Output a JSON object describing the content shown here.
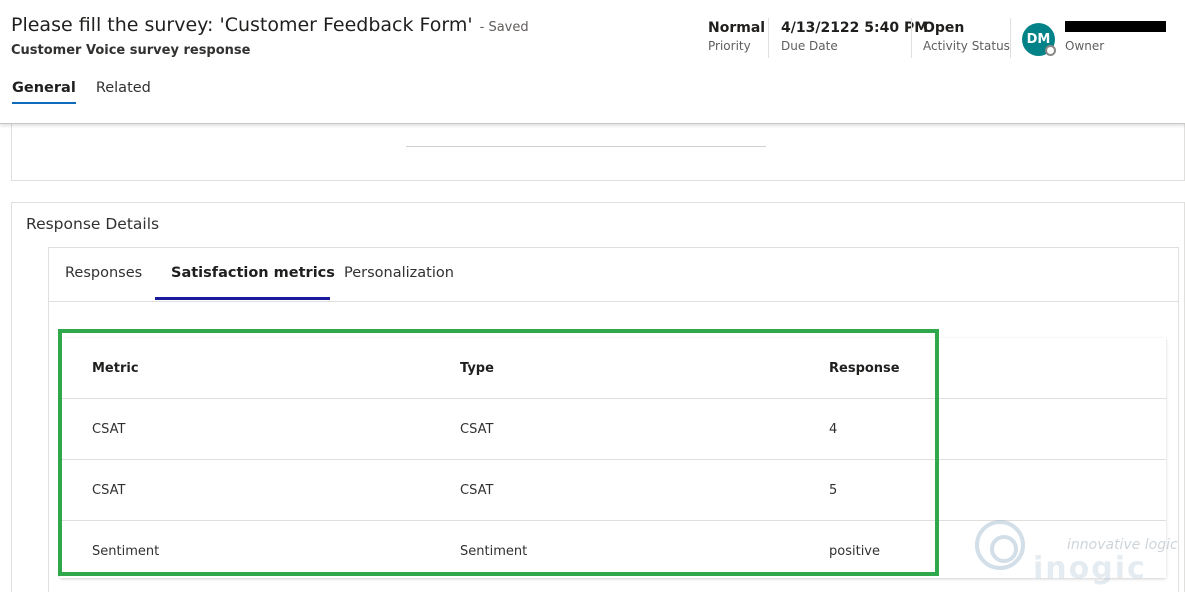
{
  "header": {
    "title": "Please fill the survey: 'Customer Feedback Form'",
    "saved_status": "- Saved",
    "subtitle": "Customer Voice survey response",
    "fields": [
      {
        "value": "Normal",
        "label": "Priority"
      },
      {
        "value": "4/13/2122 5:40 PM",
        "label": "Due Date"
      },
      {
        "value": "Open",
        "label": "Activity Status"
      }
    ],
    "owner": {
      "initials": "DM",
      "label": "Owner"
    }
  },
  "tabs": [
    {
      "label": "General",
      "active": true
    },
    {
      "label": "Related",
      "active": false
    }
  ],
  "response_details": {
    "title": "Response Details",
    "tabs": [
      {
        "label": "Responses"
      },
      {
        "label": "Satisfaction metrics"
      },
      {
        "label": "Personalization"
      }
    ],
    "active_tab": "Satisfaction metrics"
  },
  "metrics_table": {
    "columns": [
      "Metric",
      "Type",
      "Response"
    ],
    "rows": [
      [
        "CSAT",
        "CSAT",
        "4"
      ],
      [
        "CSAT",
        "CSAT",
        "5"
      ],
      [
        "Sentiment",
        "Sentiment",
        "positive"
      ]
    ]
  },
  "watermark": {
    "line1": "innovative logic",
    "line2": "inogic"
  },
  "colors": {
    "accent_tab": "#0f6cbd",
    "inner_tab_underline": "#1b1b9e",
    "highlight_border": "#2ea84a",
    "avatar_bg": "#038387"
  }
}
